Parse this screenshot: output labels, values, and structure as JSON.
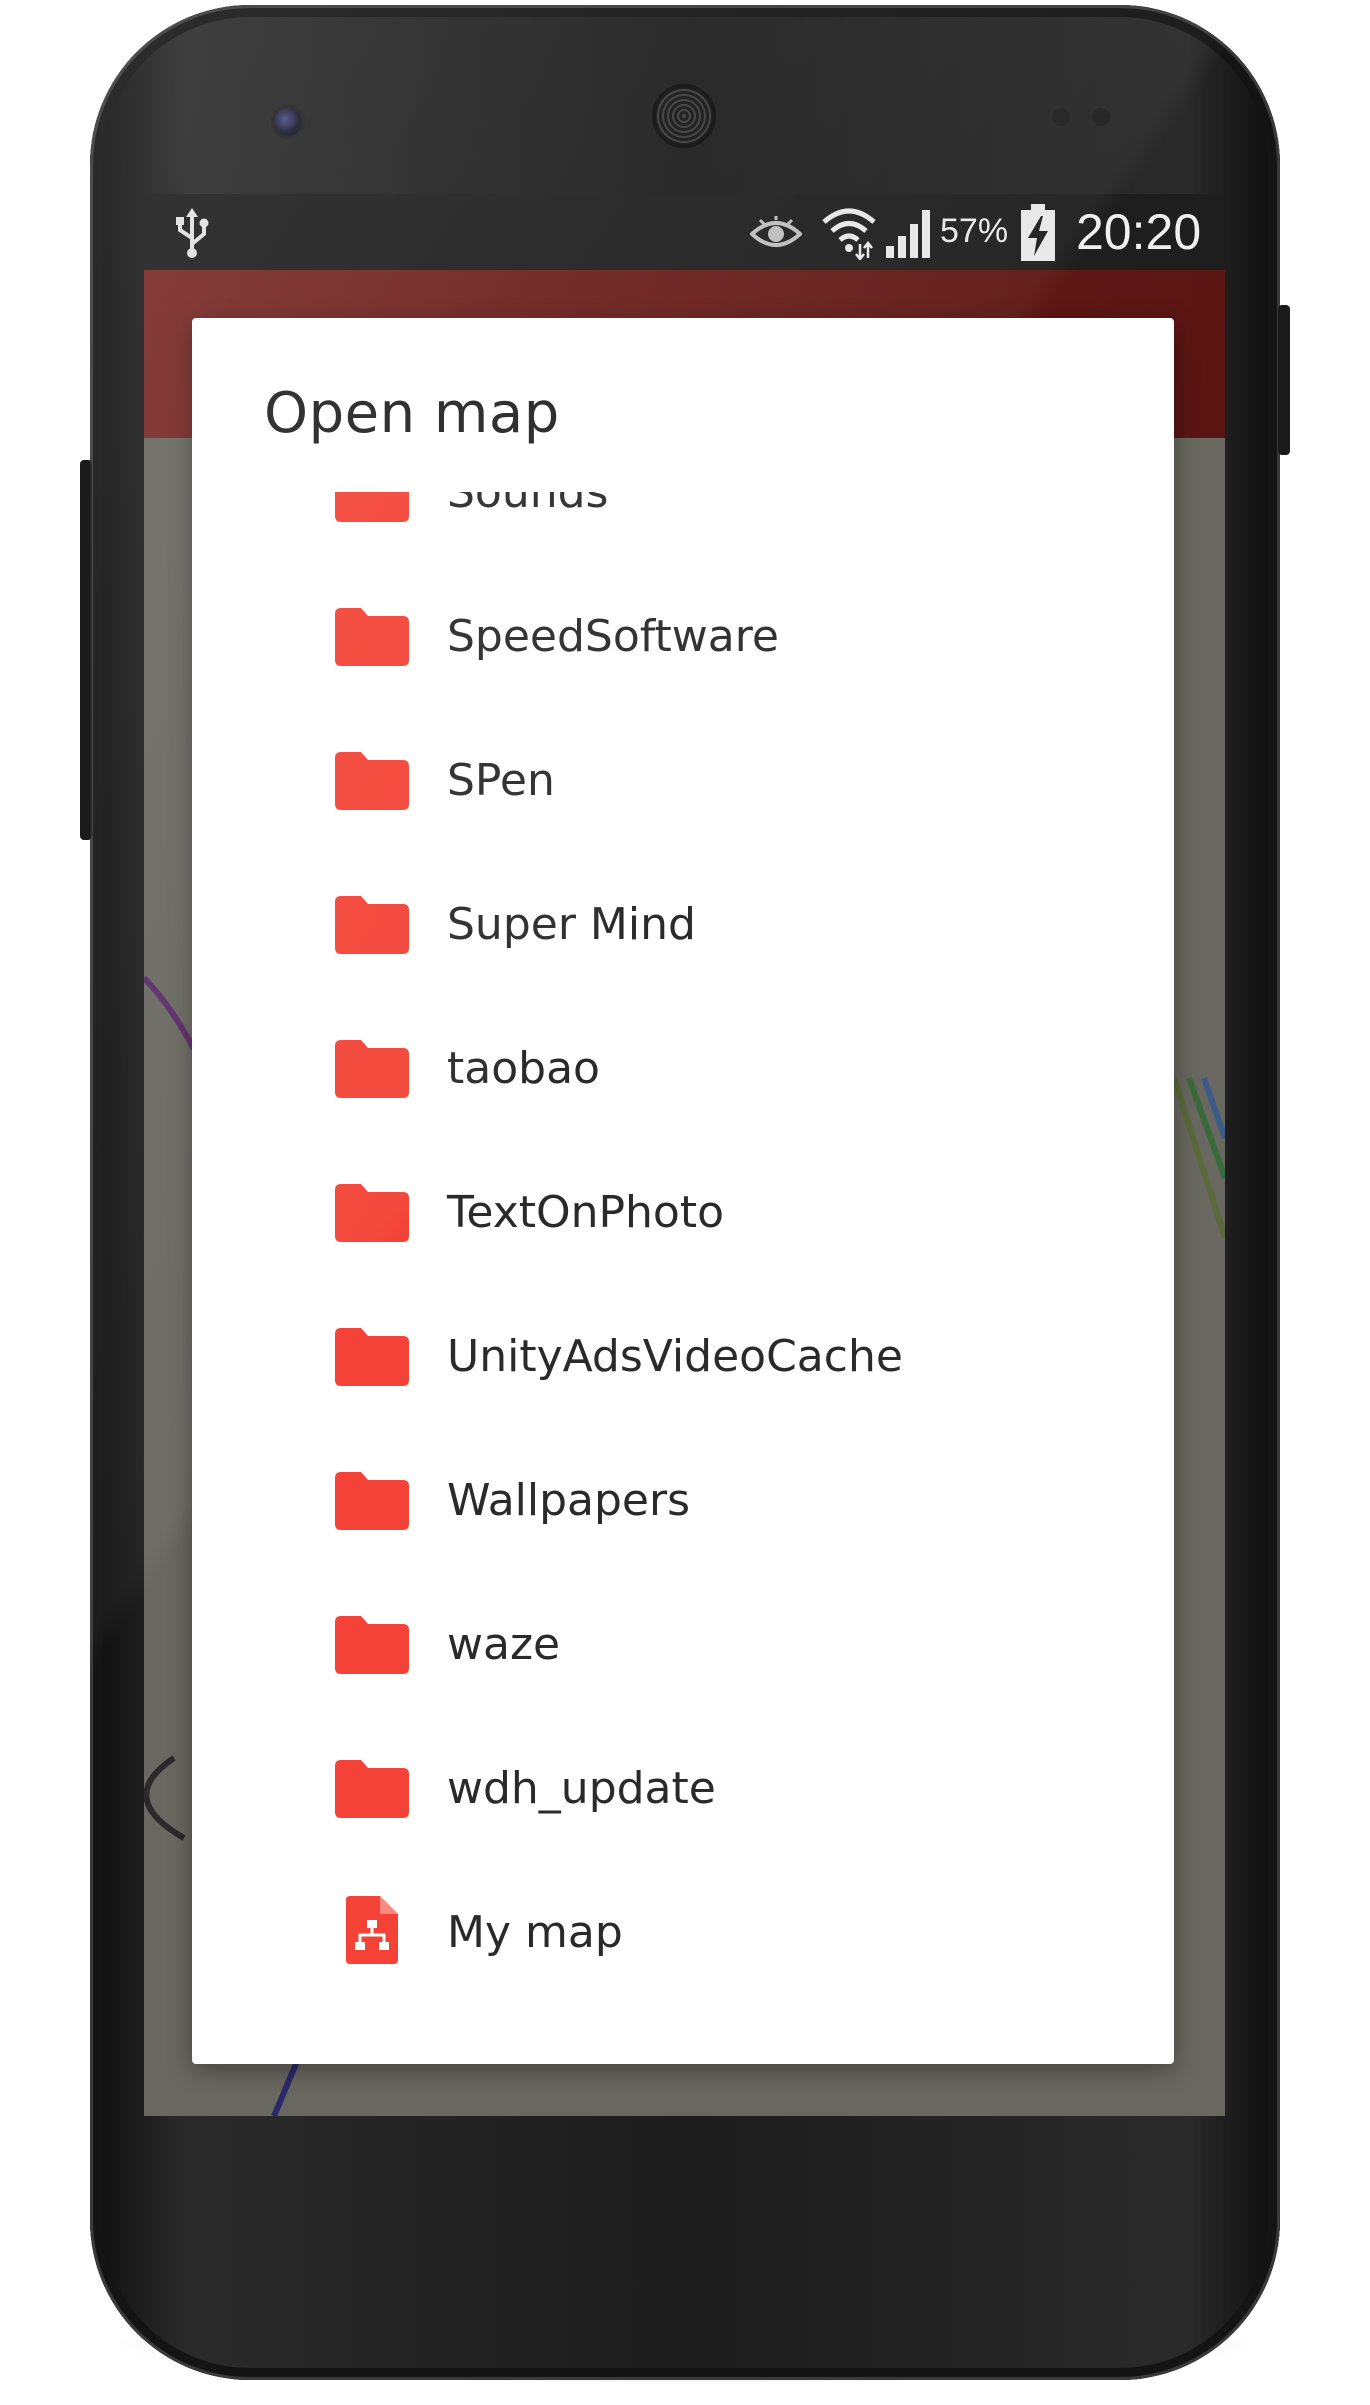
{
  "status_bar": {
    "battery_percent": "57%",
    "time": "20:20",
    "icons": [
      "usb-icon",
      "eye-icon",
      "wifi-icon",
      "signal-icon",
      "battery-charging-icon"
    ]
  },
  "app": {
    "bar_color": "#6a1e1a",
    "accent": "#f44336"
  },
  "dialog": {
    "title": "Open map",
    "items": [
      {
        "label": "Sounds",
        "type": "folder"
      },
      {
        "label": "SpeedSoftware",
        "type": "folder"
      },
      {
        "label": "SPen",
        "type": "folder"
      },
      {
        "label": "Super Mind",
        "type": "folder"
      },
      {
        "label": "taobao",
        "type": "folder"
      },
      {
        "label": "TextOnPhoto",
        "type": "folder"
      },
      {
        "label": "UnityAdsVideoCache",
        "type": "folder"
      },
      {
        "label": "Wallpapers",
        "type": "folder"
      },
      {
        "label": "waze",
        "type": "folder"
      },
      {
        "label": "wdh_update",
        "type": "folder"
      },
      {
        "label": "My map",
        "type": "mindmap-file"
      }
    ]
  }
}
